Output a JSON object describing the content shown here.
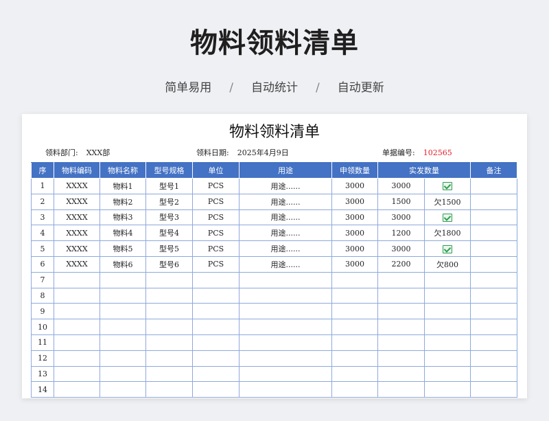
{
  "header": {
    "title": "物料领料清单",
    "subtitle": [
      "简单易用",
      "自动统计",
      "自动更新"
    ],
    "separator": "/"
  },
  "sheet": {
    "title": "物料领料清单",
    "meta": {
      "dept_label": "领料部门:",
      "dept_value": "XXX部",
      "date_label": "领料日期:",
      "date_value": "2025年4月9日",
      "docno_label": "单据编号:",
      "docno_value": "102565"
    },
    "columns": [
      "序",
      "物料编码",
      "物料名称",
      "型号规格",
      "单位",
      "用途",
      "申领数量",
      "实发数量",
      "备注"
    ],
    "rows": [
      {
        "no": "1",
        "code": "XXXX",
        "name": "物料1",
        "model": "型号1",
        "unit": "PCS",
        "use": "用途......",
        "req": "3000",
        "issued": "3000",
        "status": "",
        "status_icon": "check-icon",
        "note": ""
      },
      {
        "no": "2",
        "code": "XXXX",
        "name": "物料2",
        "model": "型号2",
        "unit": "PCS",
        "use": "用途......",
        "req": "3000",
        "issued": "1500",
        "status": "欠1500",
        "status_icon": "",
        "note": ""
      },
      {
        "no": "3",
        "code": "XXXX",
        "name": "物料3",
        "model": "型号3",
        "unit": "PCS",
        "use": "用途......",
        "req": "3000",
        "issued": "3000",
        "status": "",
        "status_icon": "check-icon",
        "note": ""
      },
      {
        "no": "4",
        "code": "XXXX",
        "name": "物料4",
        "model": "型号4",
        "unit": "PCS",
        "use": "用途......",
        "req": "3000",
        "issued": "1200",
        "status": "欠1800",
        "status_icon": "",
        "note": ""
      },
      {
        "no": "5",
        "code": "XXXX",
        "name": "物料5",
        "model": "型号5",
        "unit": "PCS",
        "use": "用途......",
        "req": "3000",
        "issued": "3000",
        "status": "",
        "status_icon": "check-icon",
        "note": ""
      },
      {
        "no": "6",
        "code": "XXXX",
        "name": "物料6",
        "model": "型号6",
        "unit": "PCS",
        "use": "用途......",
        "req": "3000",
        "issued": "2200",
        "status": "欠800",
        "status_icon": "",
        "note": ""
      },
      {
        "no": "7"
      },
      {
        "no": "8"
      },
      {
        "no": "9"
      },
      {
        "no": "10"
      },
      {
        "no": "11"
      },
      {
        "no": "12"
      },
      {
        "no": "13"
      },
      {
        "no": "14"
      }
    ],
    "colors": {
      "header_bg": "#4472c4",
      "grid_line": "#8ea9db",
      "docno_red": "#e0202c",
      "check_green": "#2e9e4f"
    }
  }
}
